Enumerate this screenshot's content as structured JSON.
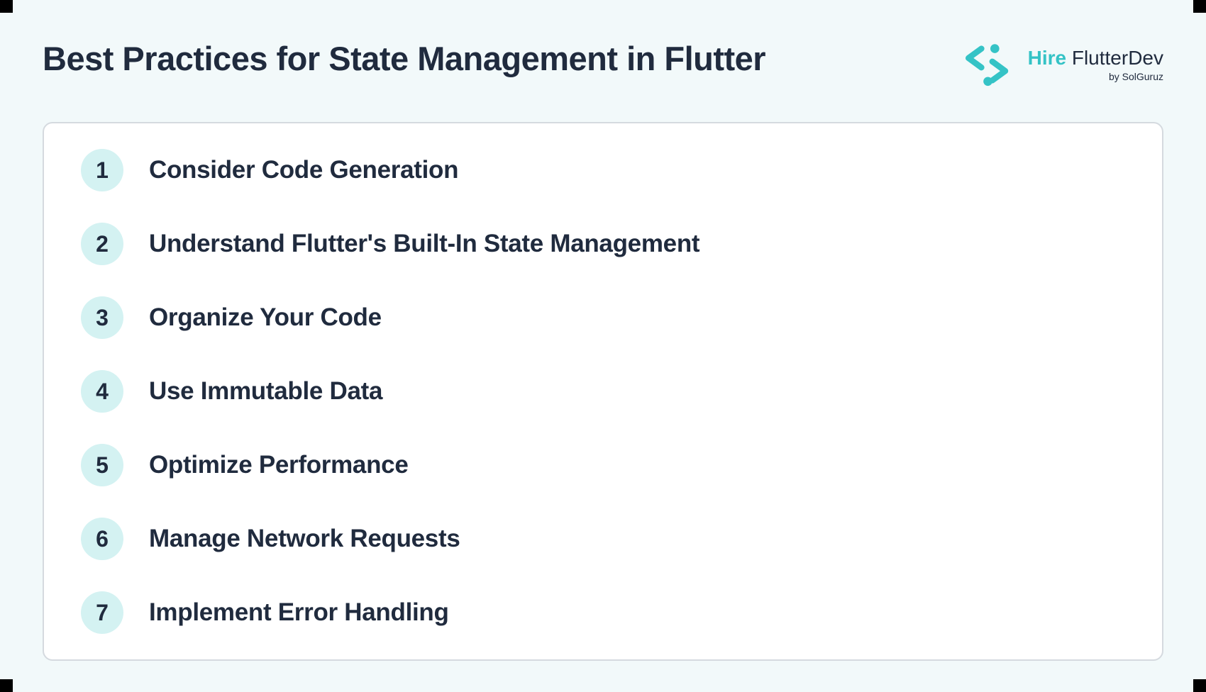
{
  "title": "Best Practices for State Management in Flutter",
  "logo": {
    "brand_hire": "Hire",
    "brand_rest": " FlutterDev",
    "subtitle": "by SolGuruz"
  },
  "items": [
    {
      "num": "1",
      "label": "Consider Code Generation"
    },
    {
      "num": "2",
      "label": "Understand Flutter's Built-In State Management"
    },
    {
      "num": "3",
      "label": "Organize Your Code"
    },
    {
      "num": "4",
      "label": "Use Immutable Data"
    },
    {
      "num": "5",
      "label": "Optimize Performance"
    },
    {
      "num": "6",
      "label": "Manage Network Requests"
    },
    {
      "num": "7",
      "label": "Implement Error Handling"
    }
  ]
}
